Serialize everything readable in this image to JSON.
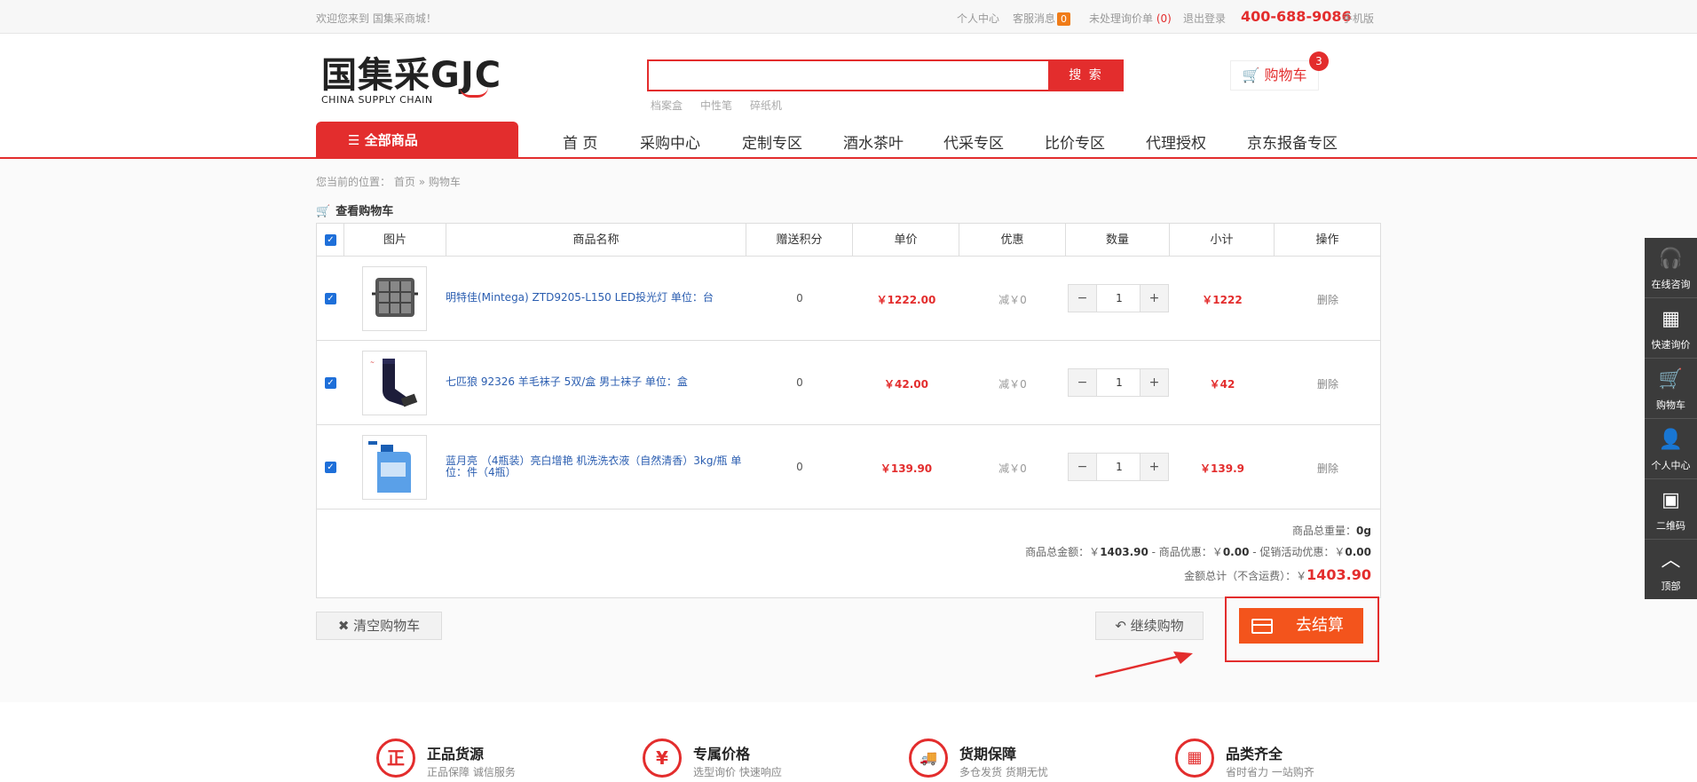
{
  "topbar": {
    "welcome": "欢迎您来到 国集采商城！",
    "personal_center": "个人中心",
    "service_msg": "客服消息",
    "service_count": "0",
    "pending_inquiry": "未处理询价单",
    "pending_count": "(0)",
    "logout": "退出登录",
    "hotline": "400-688-9086",
    "mobile": "手机版"
  },
  "header": {
    "logo_cn": "国集采GJC",
    "logo_en": "CHINA SUPPLY CHAIN",
    "search_placeholder": "",
    "search_btn": "搜 索",
    "hotwords": [
      "档案盒",
      "中性笔",
      "碎纸机"
    ],
    "cart_label": "购物车",
    "cart_count": "3"
  },
  "nav": {
    "all_goods": "全部商品",
    "items": [
      "首 页",
      "采购中心",
      "定制专区",
      "酒水茶叶",
      "代采专区",
      "比价专区",
      "代理授权",
      "京东报备专区"
    ]
  },
  "breadcrumb": {
    "prefix": "您当前的位置：",
    "home": "首页",
    "sep": "»",
    "current": "购物车"
  },
  "cart": {
    "title": "查看购物车",
    "headers": [
      "图片",
      "商品名称",
      "赠送积分",
      "单价",
      "优惠",
      "数量",
      "小计",
      "操作"
    ],
    "items": [
      {
        "name": "明特佳(Mintega) ZTD9205-L150 LED投光灯 单位：台",
        "points": "0",
        "price": "￥1222.00",
        "discount": "减￥0",
        "qty": "1",
        "subtotal": "￥1222",
        "action": "删除"
      },
      {
        "name": "七匹狼 92326 羊毛袜子 5双/盒 男士袜子 单位：盒",
        "points": "0",
        "price": "￥42.00",
        "discount": "减￥0",
        "qty": "1",
        "subtotal": "￥42",
        "action": "删除"
      },
      {
        "name": "蓝月亮 （4瓶装）亮白增艳 机洗洗衣液（自然清香）3kg/瓶 单位：件（4瓶）",
        "points": "0",
        "price": "￥139.90",
        "discount": "减￥0",
        "qty": "1",
        "subtotal": "￥139.9",
        "action": "删除"
      }
    ],
    "weight_label": "商品总重量：",
    "weight": "0g",
    "amount_label": "商品总金额：￥",
    "amount": "1403.90",
    "goods_disc_label": " - 商品优惠：￥",
    "goods_disc": "0.00",
    "promo_label": " - 促销活动优惠：￥",
    "promo": "0.00",
    "total_label": "金额总计（不含运费）：￥",
    "total": "1403.90",
    "minus": "−",
    "plus": "+"
  },
  "actions": {
    "clear": "清空购物车",
    "continue": "继续购物",
    "checkout": "去结算"
  },
  "sidebar": [
    {
      "icon": "headset-icon",
      "label": "在线咨询"
    },
    {
      "icon": "grid-icon",
      "label": "快速询价"
    },
    {
      "icon": "cart-icon",
      "label": "购物车"
    },
    {
      "icon": "user-icon",
      "label": "个人中心"
    },
    {
      "icon": "qrcode-icon",
      "label": "二维码"
    },
    {
      "icon": "up-icon",
      "label": "顶部"
    }
  ],
  "features": [
    {
      "icon": "正",
      "title": "正品货源",
      "sub": "正品保障 诚信服务"
    },
    {
      "icon": "¥",
      "title": "专属价格",
      "sub": "选型询价 快速响应"
    },
    {
      "icon": "truck",
      "title": "货期保障",
      "sub": "多仓发货 货期无忧"
    },
    {
      "icon": "grid",
      "title": "品类齐全",
      "sub": "省时省力 一站购齐"
    }
  ],
  "colors": {
    "brand": "#e32d2d",
    "checkout": "#f3541c",
    "link": "#2a5db0"
  }
}
